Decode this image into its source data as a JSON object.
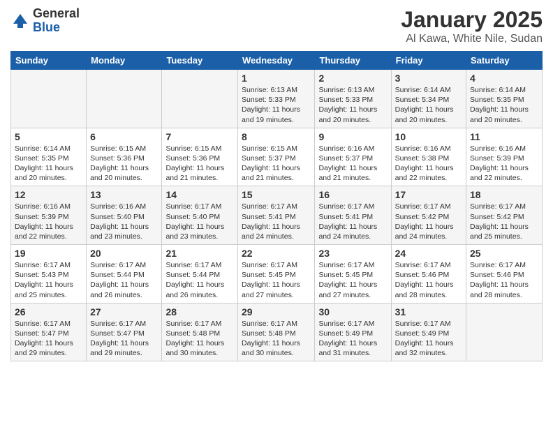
{
  "header": {
    "logo": {
      "general": "General",
      "blue": "Blue"
    },
    "title": "January 2025",
    "subtitle": "Al Kawa, White Nile, Sudan"
  },
  "calendar": {
    "days_of_week": [
      "Sunday",
      "Monday",
      "Tuesday",
      "Wednesday",
      "Thursday",
      "Friday",
      "Saturday"
    ],
    "weeks": [
      [
        {
          "day": "",
          "info": ""
        },
        {
          "day": "",
          "info": ""
        },
        {
          "day": "",
          "info": ""
        },
        {
          "day": "1",
          "info": "Sunrise: 6:13 AM\nSunset: 5:33 PM\nDaylight: 11 hours and 19 minutes."
        },
        {
          "day": "2",
          "info": "Sunrise: 6:13 AM\nSunset: 5:33 PM\nDaylight: 11 hours and 20 minutes."
        },
        {
          "day": "3",
          "info": "Sunrise: 6:14 AM\nSunset: 5:34 PM\nDaylight: 11 hours and 20 minutes."
        },
        {
          "day": "4",
          "info": "Sunrise: 6:14 AM\nSunset: 5:35 PM\nDaylight: 11 hours and 20 minutes."
        }
      ],
      [
        {
          "day": "5",
          "info": "Sunrise: 6:14 AM\nSunset: 5:35 PM\nDaylight: 11 hours and 20 minutes."
        },
        {
          "day": "6",
          "info": "Sunrise: 6:15 AM\nSunset: 5:36 PM\nDaylight: 11 hours and 20 minutes."
        },
        {
          "day": "7",
          "info": "Sunrise: 6:15 AM\nSunset: 5:36 PM\nDaylight: 11 hours and 21 minutes."
        },
        {
          "day": "8",
          "info": "Sunrise: 6:15 AM\nSunset: 5:37 PM\nDaylight: 11 hours and 21 minutes."
        },
        {
          "day": "9",
          "info": "Sunrise: 6:16 AM\nSunset: 5:37 PM\nDaylight: 11 hours and 21 minutes."
        },
        {
          "day": "10",
          "info": "Sunrise: 6:16 AM\nSunset: 5:38 PM\nDaylight: 11 hours and 22 minutes."
        },
        {
          "day": "11",
          "info": "Sunrise: 6:16 AM\nSunset: 5:39 PM\nDaylight: 11 hours and 22 minutes."
        }
      ],
      [
        {
          "day": "12",
          "info": "Sunrise: 6:16 AM\nSunset: 5:39 PM\nDaylight: 11 hours and 22 minutes."
        },
        {
          "day": "13",
          "info": "Sunrise: 6:16 AM\nSunset: 5:40 PM\nDaylight: 11 hours and 23 minutes."
        },
        {
          "day": "14",
          "info": "Sunrise: 6:17 AM\nSunset: 5:40 PM\nDaylight: 11 hours and 23 minutes."
        },
        {
          "day": "15",
          "info": "Sunrise: 6:17 AM\nSunset: 5:41 PM\nDaylight: 11 hours and 24 minutes."
        },
        {
          "day": "16",
          "info": "Sunrise: 6:17 AM\nSunset: 5:41 PM\nDaylight: 11 hours and 24 minutes."
        },
        {
          "day": "17",
          "info": "Sunrise: 6:17 AM\nSunset: 5:42 PM\nDaylight: 11 hours and 24 minutes."
        },
        {
          "day": "18",
          "info": "Sunrise: 6:17 AM\nSunset: 5:42 PM\nDaylight: 11 hours and 25 minutes."
        }
      ],
      [
        {
          "day": "19",
          "info": "Sunrise: 6:17 AM\nSunset: 5:43 PM\nDaylight: 11 hours and 25 minutes."
        },
        {
          "day": "20",
          "info": "Sunrise: 6:17 AM\nSunset: 5:44 PM\nDaylight: 11 hours and 26 minutes."
        },
        {
          "day": "21",
          "info": "Sunrise: 6:17 AM\nSunset: 5:44 PM\nDaylight: 11 hours and 26 minutes."
        },
        {
          "day": "22",
          "info": "Sunrise: 6:17 AM\nSunset: 5:45 PM\nDaylight: 11 hours and 27 minutes."
        },
        {
          "day": "23",
          "info": "Sunrise: 6:17 AM\nSunset: 5:45 PM\nDaylight: 11 hours and 27 minutes."
        },
        {
          "day": "24",
          "info": "Sunrise: 6:17 AM\nSunset: 5:46 PM\nDaylight: 11 hours and 28 minutes."
        },
        {
          "day": "25",
          "info": "Sunrise: 6:17 AM\nSunset: 5:46 PM\nDaylight: 11 hours and 28 minutes."
        }
      ],
      [
        {
          "day": "26",
          "info": "Sunrise: 6:17 AM\nSunset: 5:47 PM\nDaylight: 11 hours and 29 minutes."
        },
        {
          "day": "27",
          "info": "Sunrise: 6:17 AM\nSunset: 5:47 PM\nDaylight: 11 hours and 29 minutes."
        },
        {
          "day": "28",
          "info": "Sunrise: 6:17 AM\nSunset: 5:48 PM\nDaylight: 11 hours and 30 minutes."
        },
        {
          "day": "29",
          "info": "Sunrise: 6:17 AM\nSunset: 5:48 PM\nDaylight: 11 hours and 30 minutes."
        },
        {
          "day": "30",
          "info": "Sunrise: 6:17 AM\nSunset: 5:49 PM\nDaylight: 11 hours and 31 minutes."
        },
        {
          "day": "31",
          "info": "Sunrise: 6:17 AM\nSunset: 5:49 PM\nDaylight: 11 hours and 32 minutes."
        },
        {
          "day": "",
          "info": ""
        }
      ]
    ]
  }
}
